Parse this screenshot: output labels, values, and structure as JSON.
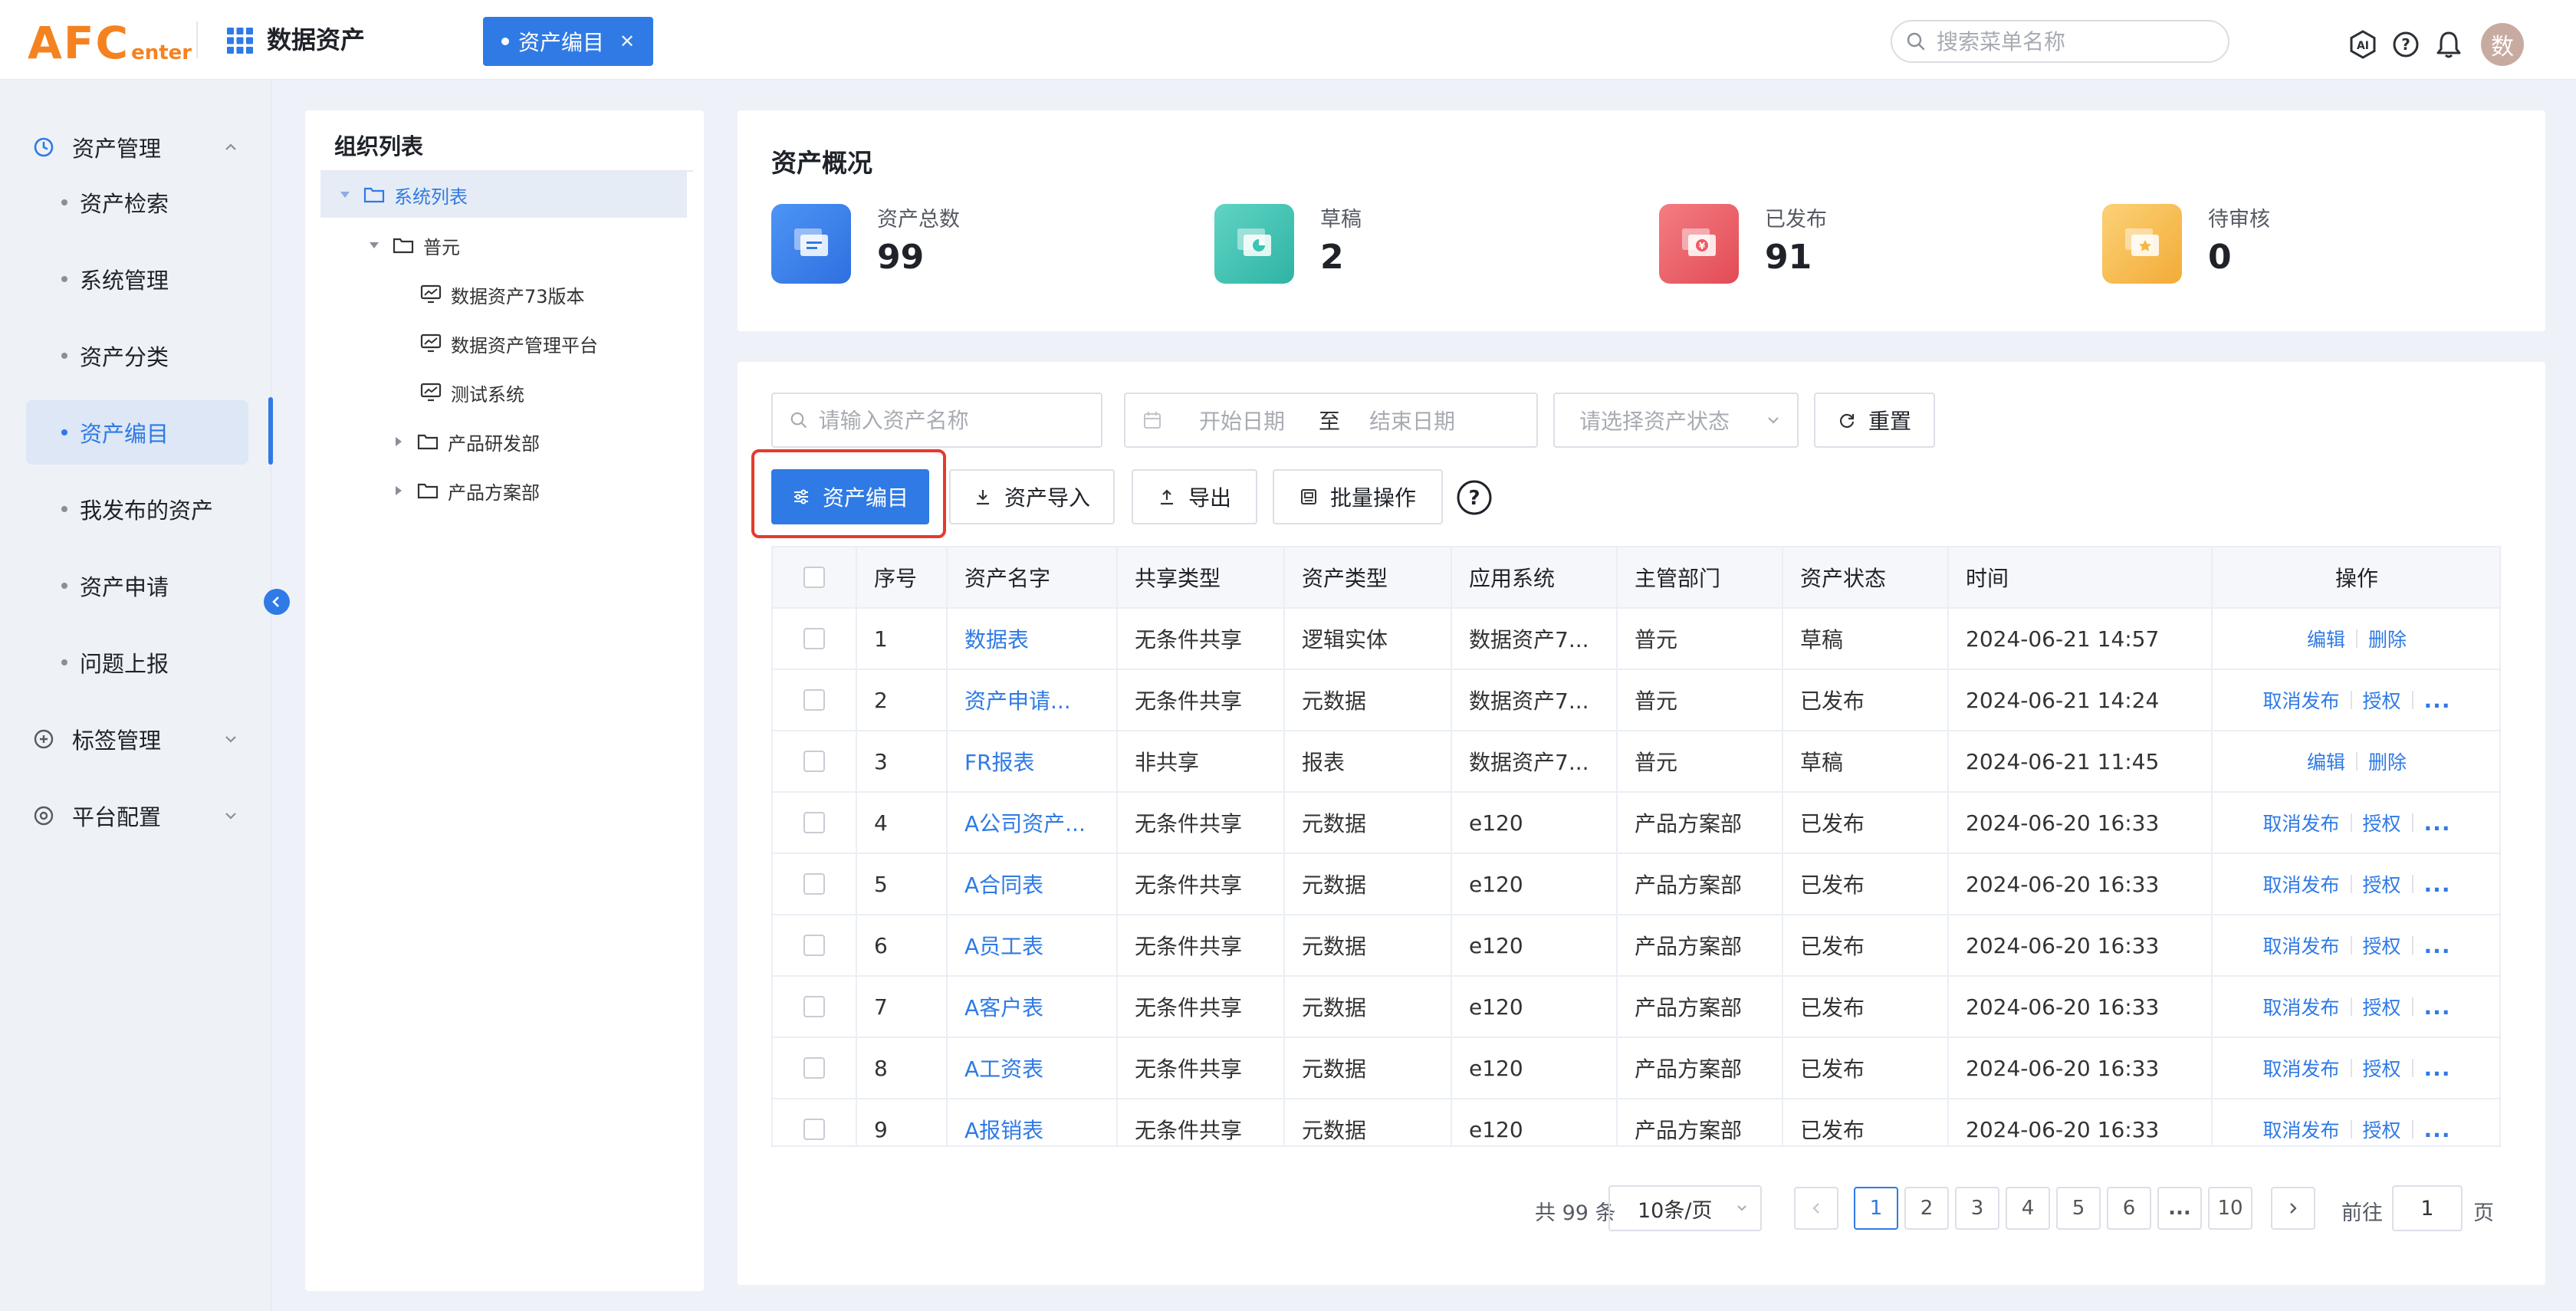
{
  "header": {
    "logo_main": "AFC",
    "logo_sub": "enter",
    "app_name": "数据资产",
    "active_tab": "资产编目",
    "search_placeholder": "搜索菜单名称",
    "avatar_text": "数"
  },
  "sidebar": {
    "groups": [
      {
        "label": "资产管理",
        "icon": "clock-icon",
        "expanded": true
      },
      {
        "label": "标签管理",
        "icon": "plus-circle-icon",
        "expanded": false
      },
      {
        "label": "平台配置",
        "icon": "target-icon",
        "expanded": false
      }
    ],
    "items": [
      {
        "label": "资产检索"
      },
      {
        "label": "系统管理"
      },
      {
        "label": "资产分类"
      },
      {
        "label": "资产编目",
        "active": true
      },
      {
        "label": "我发布的资产"
      },
      {
        "label": "资产申请"
      },
      {
        "label": "问题上报"
      }
    ]
  },
  "org": {
    "title": "组织列表",
    "tree": [
      {
        "label": "系统列表",
        "type": "folder",
        "level": 0,
        "expanded": true,
        "selected": true
      },
      {
        "label": "普元",
        "type": "folder",
        "level": 1,
        "expanded": true
      },
      {
        "label": "数据资产73版本",
        "type": "system",
        "level": 2
      },
      {
        "label": "数据资产管理平台",
        "type": "system",
        "level": 2
      },
      {
        "label": "测试系统",
        "type": "system",
        "level": 2
      },
      {
        "label": "产品研发部",
        "type": "folder",
        "level": 1,
        "expanded": false
      },
      {
        "label": "产品方案部",
        "type": "folder",
        "level": 1,
        "expanded": false
      }
    ]
  },
  "overview": {
    "title": "资产概况",
    "stats": [
      {
        "label": "资产总数",
        "value": "99",
        "color": "#2f7ae5"
      },
      {
        "label": "草稿",
        "value": "2",
        "color": "#3cc4b4"
      },
      {
        "label": "已发布",
        "value": "91",
        "color": "#ec5a62"
      },
      {
        "label": "待审核",
        "value": "0",
        "color": "#f5b740"
      }
    ]
  },
  "filters": {
    "name_placeholder": "请输入资产名称",
    "start_placeholder": "开始日期",
    "range_sep": "至",
    "end_placeholder": "结束日期",
    "status_placeholder": "请选择资产状态",
    "reset_label": "重置"
  },
  "actions": {
    "catalog_label": "资产编目",
    "import_label": "资产导入",
    "export_label": "导出",
    "batch_label": "批量操作"
  },
  "table": {
    "columns": [
      "序号",
      "资产名字",
      "共享类型",
      "资产类型",
      "应用系统",
      "主管部门",
      "资产状态",
      "时间",
      "操作"
    ],
    "rows": [
      {
        "no": "1",
        "name": "数据表",
        "share": "无条件共享",
        "type": "逻辑实体",
        "system": "数据资产7...",
        "dept": "普元",
        "status": "草稿",
        "time": "2024-06-21 14:57",
        "ops": [
          "编辑",
          "删除"
        ]
      },
      {
        "no": "2",
        "name": "资产申请...",
        "share": "无条件共享",
        "type": "元数据",
        "system": "数据资产7...",
        "dept": "普元",
        "status": "已发布",
        "time": "2024-06-21 14:24",
        "ops": [
          "取消发布",
          "授权",
          "..."
        ]
      },
      {
        "no": "3",
        "name": "FR报表",
        "share": "非共享",
        "type": "报表",
        "system": "数据资产7...",
        "dept": "普元",
        "status": "草稿",
        "time": "2024-06-21 11:45",
        "ops": [
          "编辑",
          "删除"
        ]
      },
      {
        "no": "4",
        "name": "A公司资产...",
        "share": "无条件共享",
        "type": "元数据",
        "system": "e120",
        "dept": "产品方案部",
        "status": "已发布",
        "time": "2024-06-20 16:33",
        "ops": [
          "取消发布",
          "授权",
          "..."
        ]
      },
      {
        "no": "5",
        "name": "A合同表",
        "share": "无条件共享",
        "type": "元数据",
        "system": "e120",
        "dept": "产品方案部",
        "status": "已发布",
        "time": "2024-06-20 16:33",
        "ops": [
          "取消发布",
          "授权",
          "..."
        ]
      },
      {
        "no": "6",
        "name": "A员工表",
        "share": "无条件共享",
        "type": "元数据",
        "system": "e120",
        "dept": "产品方案部",
        "status": "已发布",
        "time": "2024-06-20 16:33",
        "ops": [
          "取消发布",
          "授权",
          "..."
        ]
      },
      {
        "no": "7",
        "name": "A客户表",
        "share": "无条件共享",
        "type": "元数据",
        "system": "e120",
        "dept": "产品方案部",
        "status": "已发布",
        "time": "2024-06-20 16:33",
        "ops": [
          "取消发布",
          "授权",
          "..."
        ]
      },
      {
        "no": "8",
        "name": "A工资表",
        "share": "无条件共享",
        "type": "元数据",
        "system": "e120",
        "dept": "产品方案部",
        "status": "已发布",
        "time": "2024-06-20 16:33",
        "ops": [
          "取消发布",
          "授权",
          "..."
        ]
      },
      {
        "no": "9",
        "name": "A报销表",
        "share": "无条件共享",
        "type": "元数据",
        "system": "e120",
        "dept": "产品方案部",
        "status": "已发布",
        "time": "2024-06-20 16:33",
        "ops": [
          "取消发布",
          "授权",
          "..."
        ]
      }
    ]
  },
  "pagination": {
    "total_text": "共 99 条",
    "page_size": "10条/页",
    "pages": [
      "1",
      "2",
      "3",
      "4",
      "5",
      "6",
      "...",
      "10"
    ],
    "current_page": "1",
    "goto_label": "前往",
    "goto_value": "1",
    "page_suffix": "页"
  },
  "colors": {
    "primary": "#2f7ae5",
    "highlight": "#e53a2e",
    "logo": "#f58220"
  }
}
